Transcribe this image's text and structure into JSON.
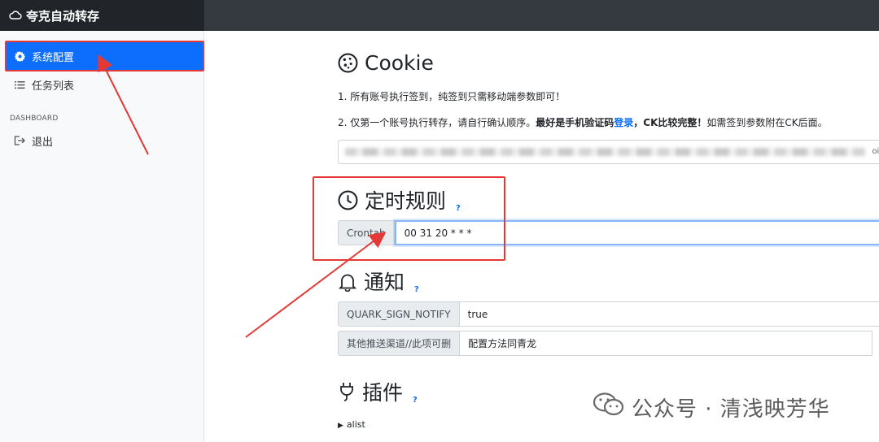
{
  "app": {
    "title": "夸克自动转存"
  },
  "sidebar": {
    "items": [
      {
        "label": "系统配置",
        "icon": "gear-icon",
        "active": true
      },
      {
        "label": "任务列表",
        "icon": "list-icon",
        "active": false
      }
    ],
    "heading": "DASHBOARD",
    "logout": {
      "label": "退出",
      "icon": "logout-icon"
    }
  },
  "cookie_section": {
    "title": "Cookie",
    "help": "?",
    "line1": "1. 所有账号执行签到，纯签到只需移动端参数即可！",
    "line2_prefix": "2. 仅第一个账号执行转存，请自行确认顺序。",
    "line2_bold": "最好是手机验证码",
    "line2_link": "登录",
    "line2_bold2": "，CK比较完整！",
    "line2_suffix": "如需签到参数附在CK后面。",
    "input_tail": "oim"
  },
  "cron_section": {
    "title": "定时规则",
    "help": "?",
    "label": "Crontab",
    "value": "00 31 20 * * *"
  },
  "notify_section": {
    "title": "通知",
    "help": "?",
    "fields": [
      {
        "label": "QUARK_SIGN_NOTIFY",
        "value": "true"
      },
      {
        "label": "其他推送渠道//此项可删",
        "value": "配置方法同青龙"
      }
    ]
  },
  "plugin_section": {
    "title": "插件",
    "help": "?",
    "items": [
      {
        "label": "alist"
      }
    ]
  },
  "watermark": {
    "text": "公众号 · 清浅映芳华"
  },
  "colors": {
    "accent": "#0d6efd",
    "annotation": "#e53935",
    "topbar": "#343a40"
  }
}
